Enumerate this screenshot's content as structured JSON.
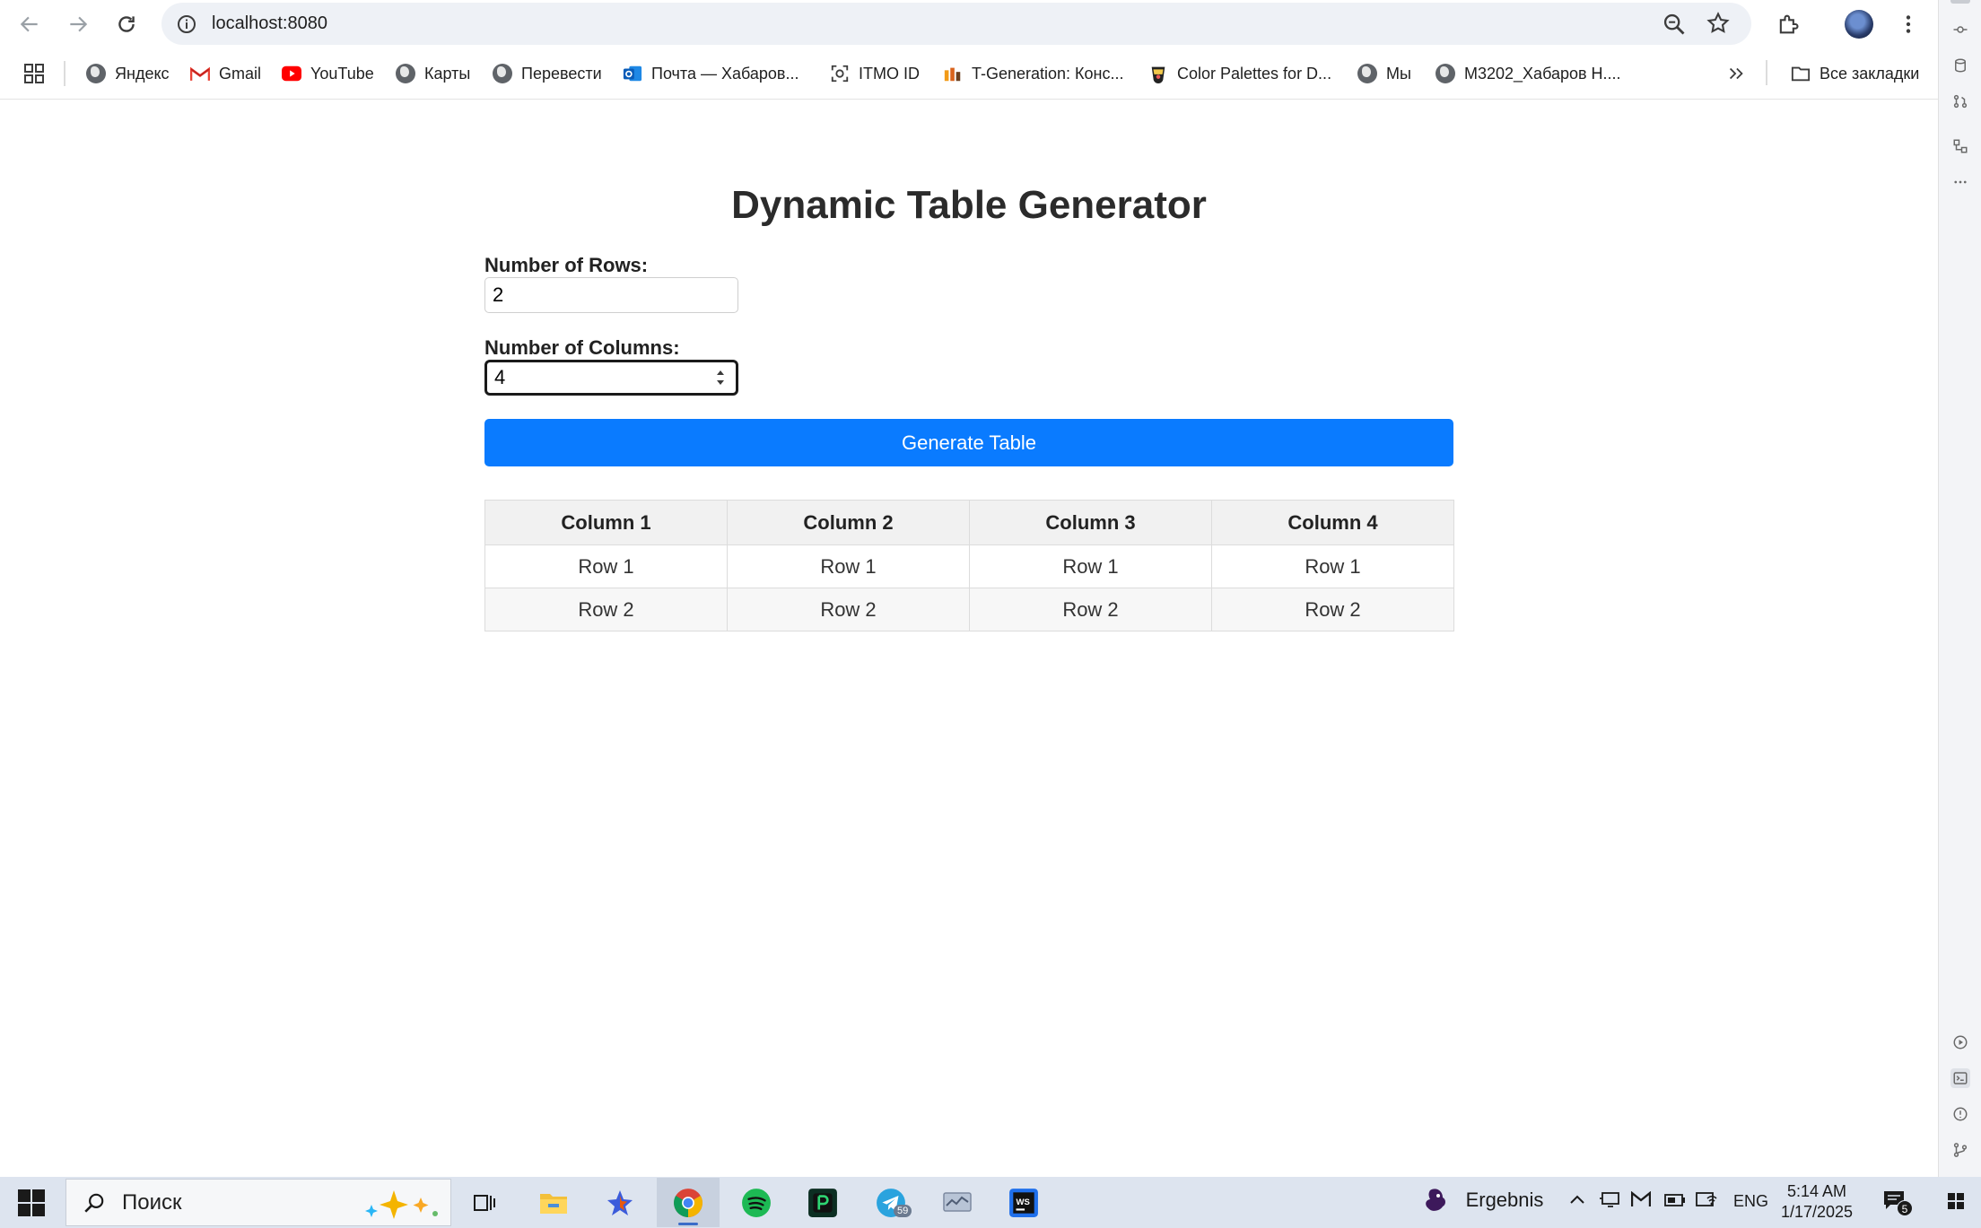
{
  "browser": {
    "url": "localhost:8080",
    "bookmarks": [
      {
        "label": "Яндекс",
        "icon": "globe-icon"
      },
      {
        "label": "Gmail",
        "icon": "gmail-icon"
      },
      {
        "label": "YouTube",
        "icon": "youtube-icon"
      },
      {
        "label": "Карты",
        "icon": "globe-icon"
      },
      {
        "label": "Перевести",
        "icon": "globe-icon"
      },
      {
        "label": "Почта — Хабаров...",
        "icon": "outlook-icon"
      },
      {
        "label": "ITMO ID",
        "icon": "itmo-icon"
      },
      {
        "label": "T-Generation: Конс...",
        "icon": "tgen-icon"
      },
      {
        "label": "Color Palettes for D...",
        "icon": "palette-icon"
      },
      {
        "label": "Мы",
        "icon": "globe-icon"
      },
      {
        "label": "M3202_Хабаров Н....",
        "icon": "globe-icon"
      }
    ],
    "all_bookmarks_label": "Все закладки"
  },
  "page": {
    "title": "Dynamic Table Generator",
    "rows_label": "Number of Rows:",
    "rows_value": "2",
    "columns_label": "Number of Columns:",
    "columns_value": "4",
    "generate_label": "Generate Table"
  },
  "table": {
    "headers": [
      "Column 1",
      "Column 2",
      "Column 3",
      "Column 4"
    ],
    "rows": [
      [
        "Row 1",
        "Row 1",
        "Row 1",
        "Row 1"
      ],
      [
        "Row 2",
        "Row 2",
        "Row 2",
        "Row 2"
      ]
    ]
  },
  "taskbar": {
    "search_placeholder": "Поиск",
    "weather_label": "Ergebnis",
    "language": "ENG",
    "time": "5:14 AM",
    "date": "1/17/2025",
    "telegram_badge": "59",
    "notifications_count": "5"
  },
  "colors": {
    "primary_button": "#0a7bff",
    "header_bg": "#f1f1f1"
  }
}
